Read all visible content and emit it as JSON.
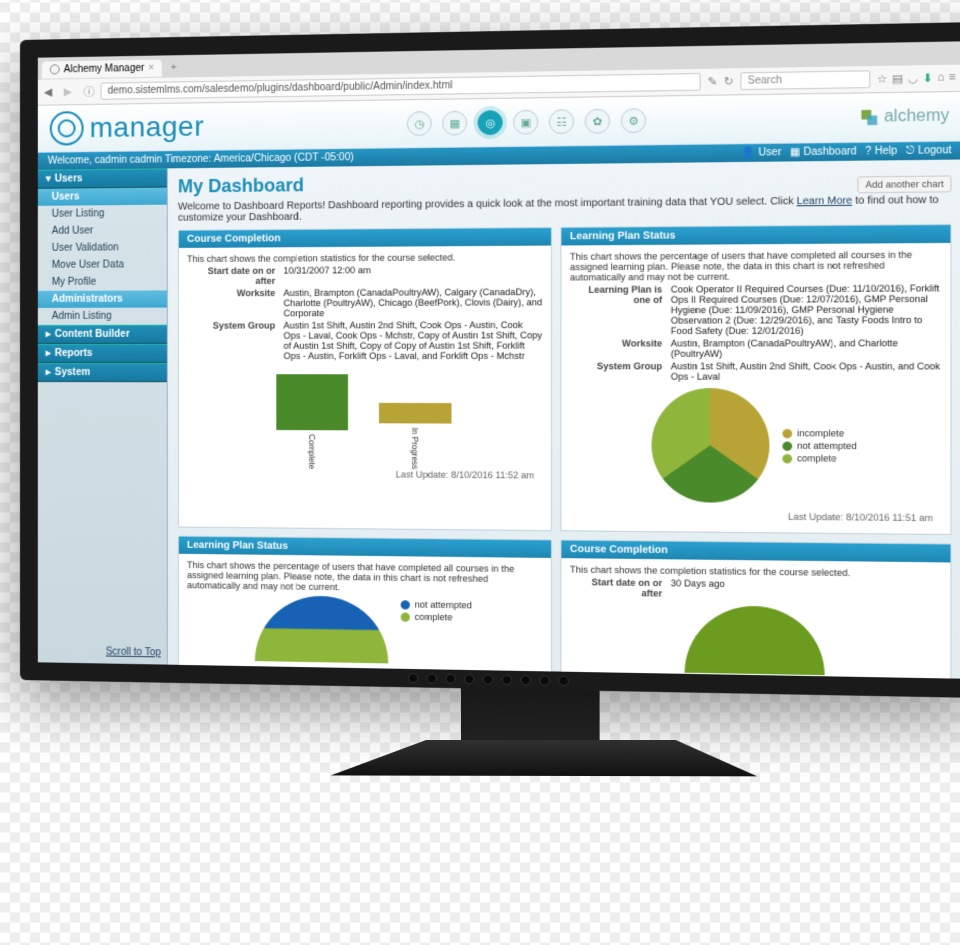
{
  "browser": {
    "tab_title": "Alchemy Manager",
    "url": "demo.sistemlms.com/salesdemo/plugins/dashboard/public/Admin/index.html",
    "search_placeholder": "Search"
  },
  "app": {
    "logo_text": "manager",
    "brand_right": "alchemy",
    "welcome": "Welcome, cadmin cadmin Timezone: America/Chicago (CDT -05:00)",
    "top_links": {
      "user": "User",
      "dashboard": "Dashboard",
      "help": "Help",
      "logout": "Logout"
    }
  },
  "sidebar": {
    "groups": [
      {
        "label": "Users",
        "open": true,
        "sections": [
          {
            "header": "Users",
            "items": [
              "User Listing",
              "Add User",
              "User Validation",
              "Move User Data",
              "My Profile"
            ]
          },
          {
            "header": "Administrators",
            "items": [
              "Admin Listing"
            ]
          }
        ]
      },
      {
        "label": "Content Builder",
        "open": false
      },
      {
        "label": "Reports",
        "open": false
      },
      {
        "label": "System",
        "open": false
      }
    ],
    "scroll_top": "Scroll to Top"
  },
  "dashboard": {
    "title": "My Dashboard",
    "intro_pre": "Welcome to Dashboard Reports! Dashboard reporting provides a quick look at the most important training data that YOU select. Click ",
    "intro_link": "Learn More",
    "intro_post": " to find out how to customize your Dashboard.",
    "add_chart": "Add another chart"
  },
  "card_cc": {
    "title": "Course Completion",
    "desc": "This chart shows the completion statistics for the course selected.",
    "fields": {
      "start_label": "Start date on or after",
      "start_value": "10/31/2007 12:00 am",
      "worksite_label": "Worksite",
      "worksite_value": "Austin, Brampton (CanadaPoultryAW), Calgary (CanadaDry), Charlotte (PoultryAW), Chicago (BeefPork), Clovis (Dairy), and Corporate",
      "sysgroup_label": "System Group",
      "sysgroup_value": "Austin 1st Shift, Austin 2nd Shift, Cook Ops - Austin, Cook Ops - Laval, Cook Ops - Mchstr, Copy of Austin 1st Shift, Copy of Austin 1st Shift, Copy of Copy of Austin 1st Shift, Forklift Ops - Austin, Forklift Ops - Laval, and Forklift Ops - Mchstr"
    },
    "last_update": "Last Update: 8/10/2016 11:52 am"
  },
  "card_lps": {
    "title": "Learning Plan Status",
    "desc": "This chart shows the percentage of users that have completed all courses in the assigned learning plan. Please note, the data in this chart is not refreshed automatically and may not be current.",
    "fields": {
      "plan_label": "Learning Plan is one of",
      "plan_value": "Cook Operator II Required Courses (Due: 11/10/2016), Forklift Ops II Required Courses (Due: 12/07/2016), GMP Personal Hygiene (Due: 11/09/2016), GMP Personal Hygiene Observation 2 (Due: 12/29/2016), and Tasty Foods Intro to Food Safety (Due: 12/01/2016)",
      "worksite_label": "Worksite",
      "worksite_value": "Austin, Brampton (CanadaPoultryAW), and Charlotte (PoultryAW)",
      "sysgroup_label": "System Group",
      "sysgroup_value": "Austin 1st Shift, Austin 2nd Shift, Cook Ops - Austin, and Cook Ops - Laval"
    },
    "last_update": "Last Update: 8/10/2016 11:51 am"
  },
  "card_lps2": {
    "title": "Learning Plan Status",
    "desc": "This chart shows the percentage of users that have completed all courses in the assigned learning plan. Please note, the data in this chart is not refreshed automatically and may not be current."
  },
  "card_cc2": {
    "title": "Course Completion",
    "desc": "This chart shows the completion statistics for the course selected.",
    "start_label": "Start date on or after",
    "start_value": "30 Days ago"
  },
  "chart_data": [
    {
      "id": "course_completion_bar",
      "type": "bar",
      "categories": [
        "Complete",
        "In Progress"
      ],
      "values": [
        55,
        20
      ],
      "colors": [
        "#4a8a2a",
        "#b8a436"
      ],
      "ylim": [
        0,
        60
      ]
    },
    {
      "id": "learning_plan_pie",
      "type": "pie",
      "series": [
        {
          "name": "incomplete",
          "value": 35,
          "color": "#b8a436"
        },
        {
          "name": "not attempted",
          "value": 30,
          "color": "#4a8a2a"
        },
        {
          "name": "complete",
          "value": 35,
          "color": "#8fb53a"
        }
      ]
    },
    {
      "id": "learning_plan_pie2_partial",
      "type": "pie",
      "series": [
        {
          "name": "not attempted",
          "value": 50,
          "color": "#1862b5"
        },
        {
          "name": "complete",
          "value": 50,
          "color": "#8fb53a"
        }
      ]
    },
    {
      "id": "course_completion_pie2_partial",
      "type": "pie",
      "series": [
        {
          "name": "complete",
          "value": 100,
          "color": "#6b9b1f"
        }
      ]
    }
  ]
}
